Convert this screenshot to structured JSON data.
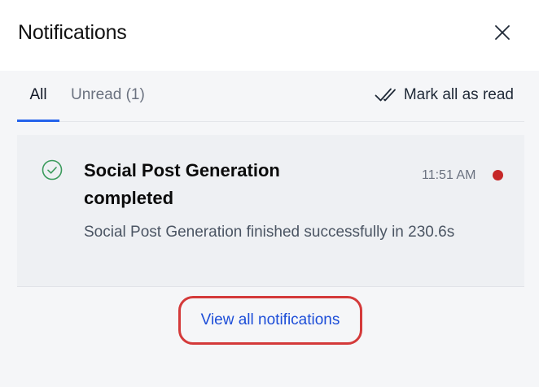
{
  "header": {
    "title": "Notifications",
    "close_icon": "close-icon"
  },
  "tabs": [
    {
      "label": "All",
      "active": true
    },
    {
      "label": "Unread (1)",
      "active": false
    }
  ],
  "mark_all": {
    "label": "Mark all as read",
    "icon": "double-check-icon"
  },
  "notifications": [
    {
      "title": "Social Post Generation completed",
      "time": "11:51 AM",
      "body": "Social Post Generation finished successfully in 230.6s",
      "icon": "check-circle-icon",
      "unread": true
    }
  ],
  "footer": {
    "view_all_label": "View all notifications"
  },
  "colors": {
    "accent": "#2563eb",
    "link": "#1d4ed8",
    "success": "#3a9a5b",
    "unread_dot": "#c62828",
    "highlight_border": "#d43a3a"
  }
}
